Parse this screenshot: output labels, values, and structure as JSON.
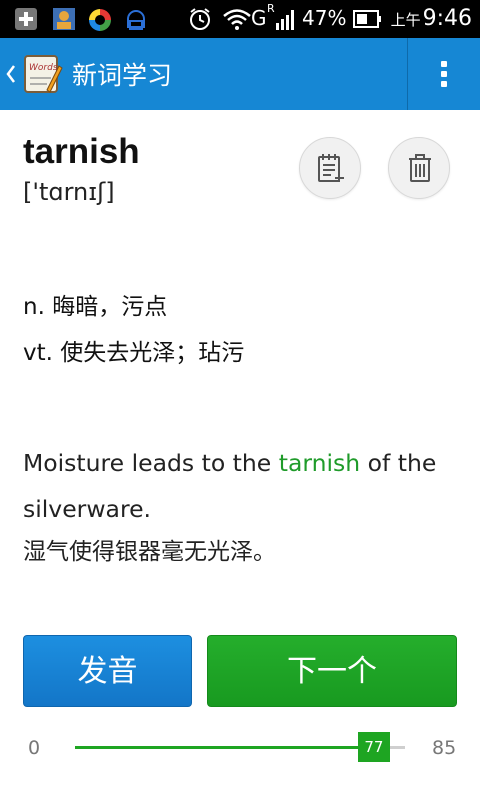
{
  "status_bar": {
    "network_label": "G",
    "network_sup": "R",
    "battery": "47%",
    "time_prefix": "上午",
    "time": "9:46",
    "icons": [
      "add-icon",
      "contacts-icon",
      "sync-icon",
      "android-icon",
      "alarm-icon",
      "wifi-icon",
      "signal-icon",
      "battery-icon"
    ]
  },
  "action_bar": {
    "title": "新词学习",
    "app_icon_text": "Words",
    "color": "#1687d4"
  },
  "word": {
    "text": "tarnish",
    "phonetic": "['tɑrnɪʃ]"
  },
  "definitions": [
    "n. 晦暗，污点",
    "vt. 使失去光泽；玷污"
  ],
  "example": {
    "before": "Moisture leads to the ",
    "highlight": "tarnish",
    "after": " of the silverware.",
    "translation": "湿气使得银器毫无光泽。",
    "highlight_color": "#1f9b2a"
  },
  "buttons": {
    "pronounce": "发音",
    "next": "下一个"
  },
  "progress": {
    "min": "0",
    "max": "85",
    "value": 77,
    "value_label": "77"
  }
}
